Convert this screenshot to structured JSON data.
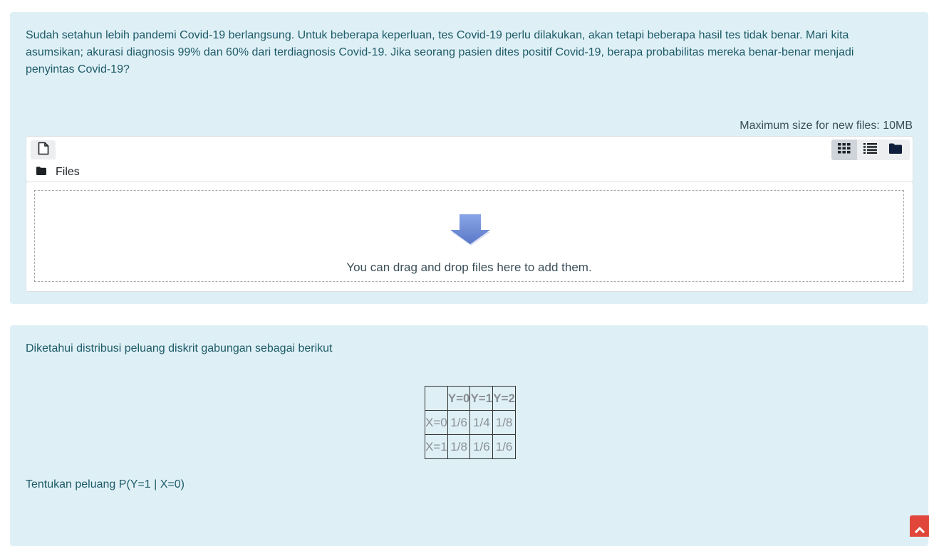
{
  "question1": {
    "text": "Sudah setahun lebih pandemi Covid-19 berlangsung. Untuk beberapa keperluan, tes Covid-19 perlu dilakukan, akan tetapi beberapa hasil tes tidak benar. Mari kita asumsikan; akurasi diagnosis 99% dan 60% dari terdiagnosis Covid-19. Jika seorang pasien dites positif Covid-19, berapa probabilitas mereka benar-benar menjadi penyintas Covid-19?",
    "max_size": "Maximum size for new files: 10MB",
    "filepicker": {
      "add_icon": "file-icon",
      "view_icons": [
        "grid-icon",
        "list-icon",
        "folder-icon"
      ],
      "path_icon": "folder-icon",
      "path_label": "Files"
    },
    "dropzone": {
      "icon": "arrow-down-icon",
      "text": "You can drag and drop files here to add them."
    }
  },
  "question2": {
    "text": "Diketahui distribusi peluang diskrit gabungan sebagai berikut",
    "table": {
      "headers": [
        "",
        "Y=0",
        "Y=1",
        "Y=2"
      ],
      "rows": [
        [
          "X=0",
          "1/6",
          "1/4",
          "1/8"
        ],
        [
          "X=1",
          "1/8",
          "1/6",
          "1/6"
        ]
      ]
    },
    "prompt": "Tentukan peluang P(Y=1 | X=0)"
  },
  "back_to_top": {
    "icon": "chevron-up-icon"
  },
  "colors": {
    "card_bg": "#def0f6",
    "text": "#1e5a68",
    "accent_button": "#e0473a",
    "arrow": "#6f8fd8"
  }
}
